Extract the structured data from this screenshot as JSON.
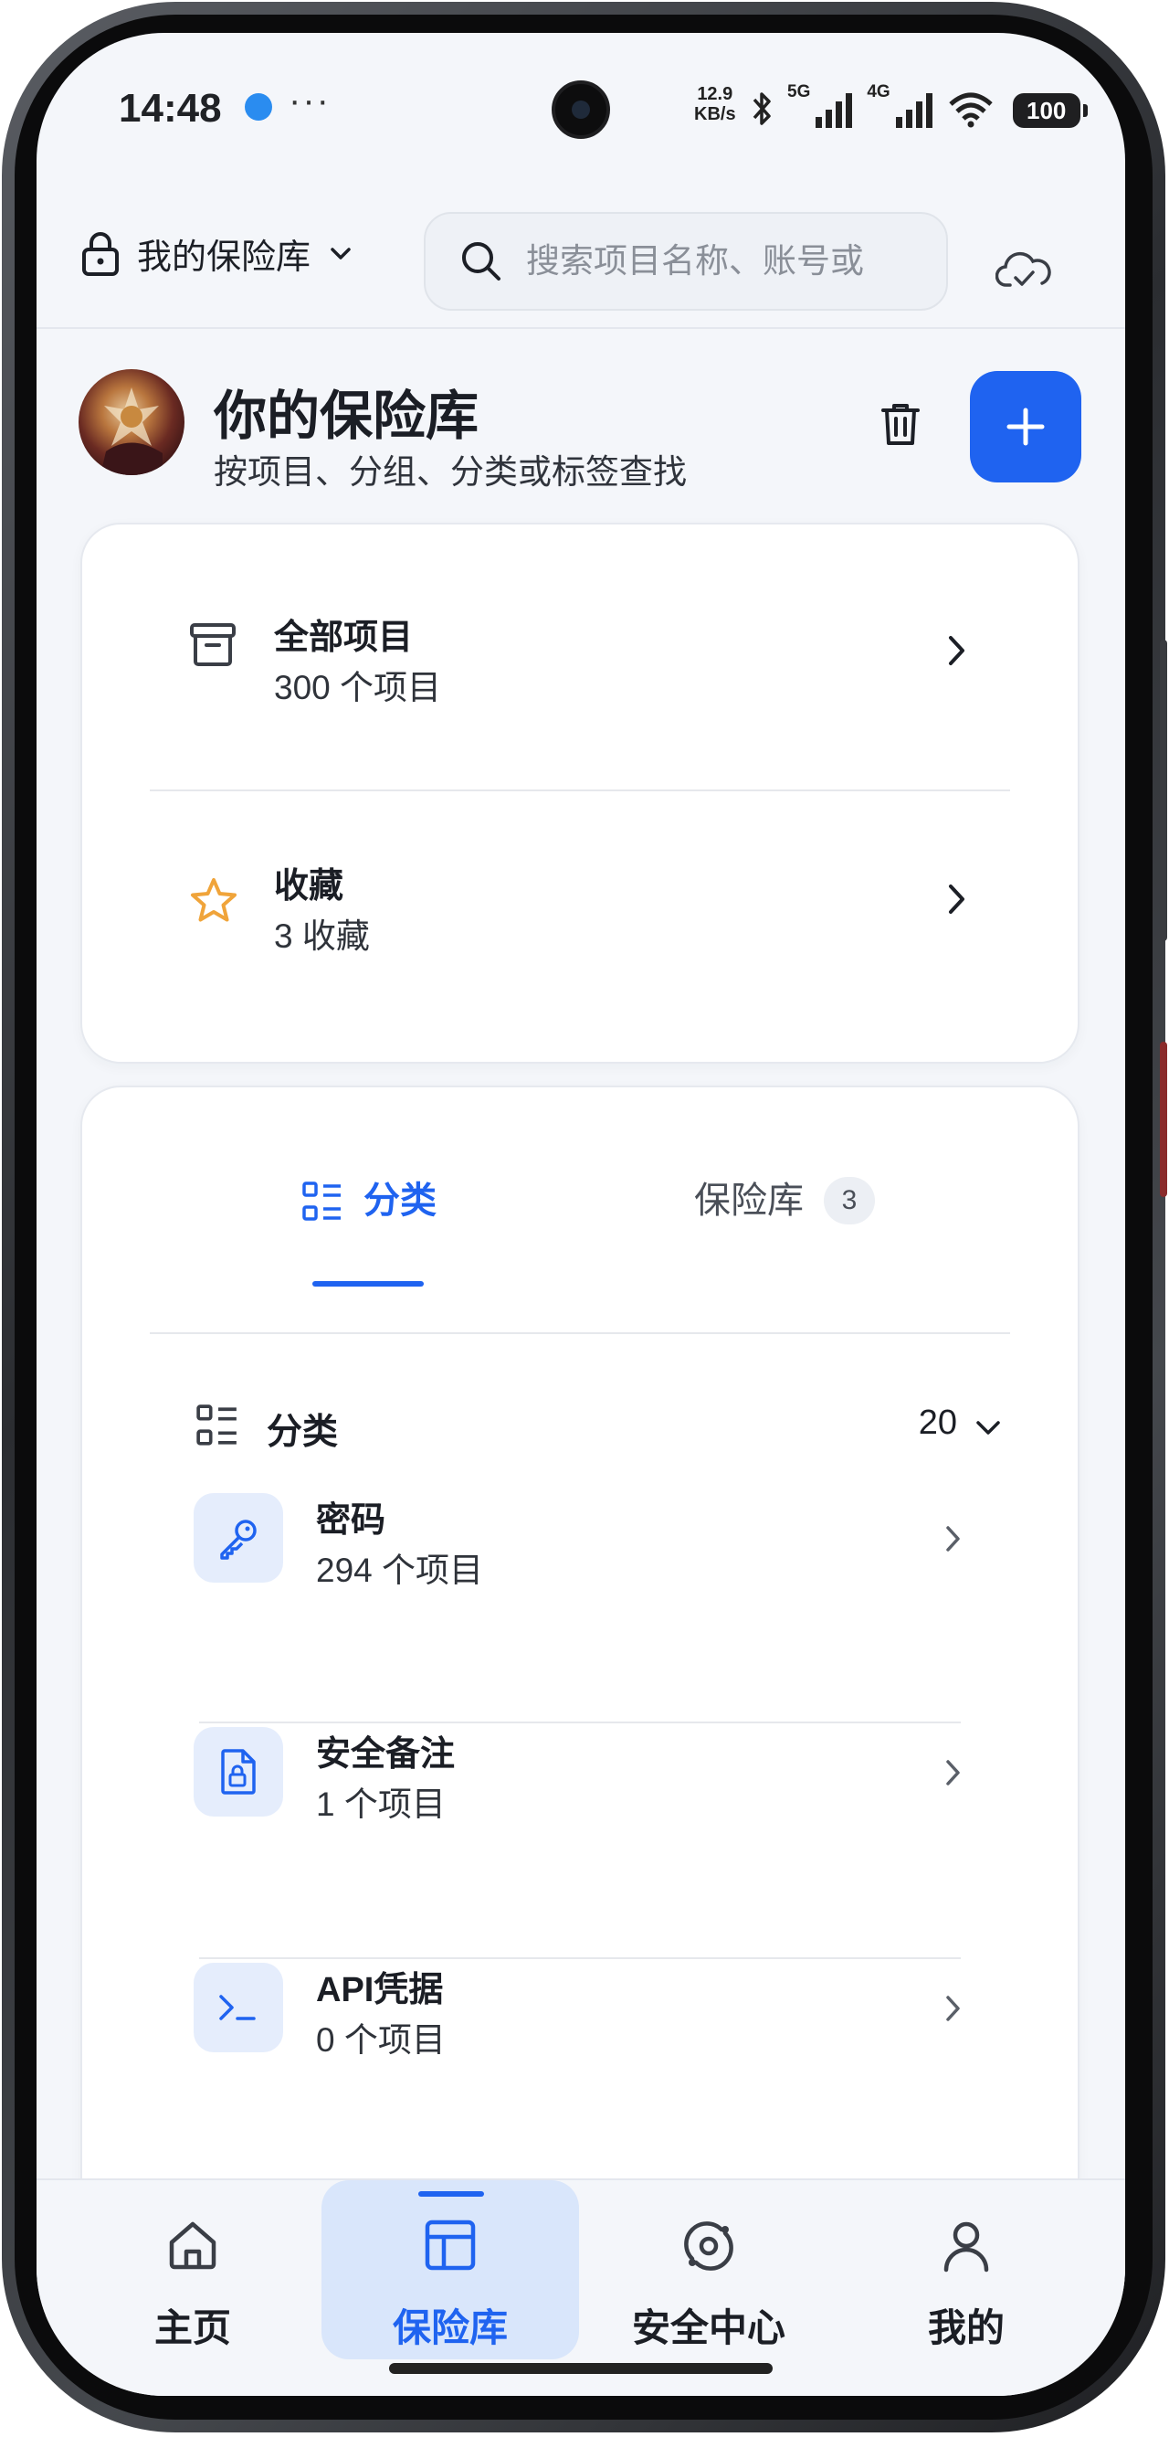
{
  "status_bar": {
    "time": "14:48",
    "dots": "···",
    "speed_line1": "12.9",
    "speed_line2": "KB/s",
    "net_5g": "5G",
    "net_4g": "4G",
    "battery": "100"
  },
  "top_bar": {
    "vault_selector_label": "我的保险库",
    "search_placeholder": "搜索项目名称、账号或"
  },
  "header": {
    "title": "你的保险库",
    "subtitle": "按项目、分组、分类或标签查找"
  },
  "quick_access": [
    {
      "title": "全部项目",
      "subtitle": "300 个项目",
      "icon": "archive-icon"
    },
    {
      "title": "收藏",
      "subtitle": "3 收藏",
      "icon": "star-icon"
    }
  ],
  "tabs": {
    "categories_label": "分类",
    "vaults_label": "保险库",
    "vaults_badge": "3"
  },
  "category_section": {
    "title": "分类",
    "count": "20"
  },
  "categories": [
    {
      "title": "密码",
      "subtitle": "294 个项目",
      "icon": "key-icon"
    },
    {
      "title": "安全备注",
      "subtitle": "1 个项目",
      "icon": "secure-note-icon"
    },
    {
      "title": "API凭据",
      "subtitle": "0 个项目",
      "icon": "terminal-icon"
    }
  ],
  "bottom_nav": [
    {
      "label": "主页",
      "icon": "home-icon"
    },
    {
      "label": "保险库",
      "icon": "vault-icon",
      "active": true
    },
    {
      "label": "安全中心",
      "icon": "security-center-icon"
    },
    {
      "label": "我的",
      "icon": "profile-icon"
    }
  ],
  "colors": {
    "accent": "#1f63f0",
    "star": "#f0a43a",
    "background": "#f4f6fa",
    "card": "#ffffff"
  }
}
